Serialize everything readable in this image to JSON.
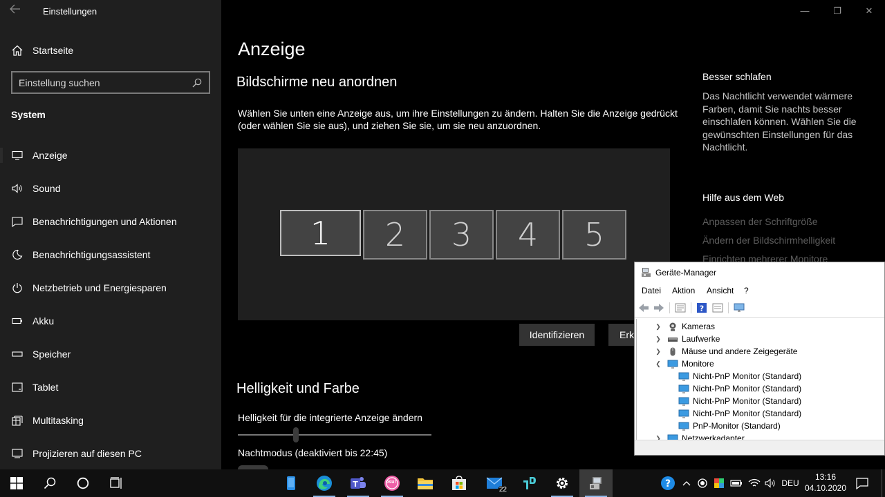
{
  "window": {
    "title": "Einstellungen",
    "back_icon": "back-arrow-icon",
    "controls": [
      "minimize-icon",
      "restore-icon",
      "close-icon"
    ]
  },
  "sidebar": {
    "home_label": "Startseite",
    "search_placeholder": "Einstellung suchen",
    "section": "System",
    "items": [
      {
        "label": "Anzeige",
        "icon": "display-icon",
        "active": true
      },
      {
        "label": "Sound",
        "icon": "speaker-icon"
      },
      {
        "label": "Benachrichtigungen und Aktionen",
        "icon": "notification-icon"
      },
      {
        "label": "Benachrichtigungsassistent",
        "icon": "moon-icon"
      },
      {
        "label": "Netzbetrieb und Energiesparen",
        "icon": "power-icon"
      },
      {
        "label": "Akku",
        "icon": "battery-icon"
      },
      {
        "label": "Speicher",
        "icon": "storage-icon"
      },
      {
        "label": "Tablet",
        "icon": "tablet-icon"
      },
      {
        "label": "Multitasking",
        "icon": "multitasking-icon"
      },
      {
        "label": "Projizieren auf diesen PC",
        "icon": "project-icon"
      }
    ]
  },
  "main": {
    "title": "Anzeige",
    "arrange_heading": "Bildschirme neu anordnen",
    "arrange_desc": "Wählen Sie unten eine Anzeige aus, um ihre Einstellungen zu ändern. Halten Sie die Anzeige gedrückt (oder wählen Sie sie aus), und ziehen Sie sie, um sie neu anzuordnen.",
    "monitors": [
      "1",
      "2",
      "3",
      "4",
      "5"
    ],
    "identify_label": "Identifizieren",
    "detect_label": "Erke",
    "brightness_heading": "Helligkeit und Farbe",
    "brightness_label": "Helligkeit für die integrierte Anzeige ändern",
    "brightness_value": 0.3,
    "nightmode_label": "Nachtmodus (deaktiviert bis 22:45)"
  },
  "aside": {
    "sleep_heading": "Besser schlafen",
    "sleep_text": "Das Nachtlicht verwendet wärmere Farben, damit Sie nachts besser einschlafen können. Wählen Sie die gewünschten Einstellungen für das Nachtlicht.",
    "help_heading": "Hilfe aus dem Web",
    "help_links": [
      "Anpassen der Schriftgröße",
      "Ändern der Bildschirmhelligkeit",
      "Einrichten mehrerer Monitore"
    ]
  },
  "device_manager": {
    "title": "Geräte-Manager",
    "menu": [
      "Datei",
      "Aktion",
      "Ansicht",
      "?"
    ],
    "tree": [
      {
        "label": "Kameras",
        "level": 0,
        "expander": "collapsed",
        "icon": "camera-icon"
      },
      {
        "label": "Laufwerke",
        "level": 0,
        "expander": "collapsed",
        "icon": "drive-icon"
      },
      {
        "label": "Mäuse und andere Zeigegeräte",
        "level": 0,
        "expander": "collapsed",
        "icon": "mouse-icon"
      },
      {
        "label": "Monitore",
        "level": 0,
        "expander": "expanded",
        "icon": "monitor-icon"
      },
      {
        "label": "Nicht-PnP Monitor (Standard)",
        "level": 1,
        "icon": "monitor-icon"
      },
      {
        "label": "Nicht-PnP Monitor (Standard)",
        "level": 1,
        "icon": "monitor-icon"
      },
      {
        "label": "Nicht-PnP Monitor (Standard)",
        "level": 1,
        "icon": "monitor-icon"
      },
      {
        "label": "Nicht-PnP Monitor (Standard)",
        "level": 1,
        "icon": "monitor-icon"
      },
      {
        "label": "PnP-Monitor (Standard)",
        "level": 1,
        "icon": "monitor-icon"
      },
      {
        "label": "Netzwerkadapter",
        "level": 0,
        "expander": "collapsed",
        "icon": "network-adapter-icon"
      }
    ]
  },
  "taskbar": {
    "mail_badge": "22",
    "osu_label": "osu!",
    "language": "DEU",
    "time": "13:16",
    "date": "04.10.2020",
    "colors": {
      "accent": "#0078d7",
      "bg": "#101010"
    }
  }
}
